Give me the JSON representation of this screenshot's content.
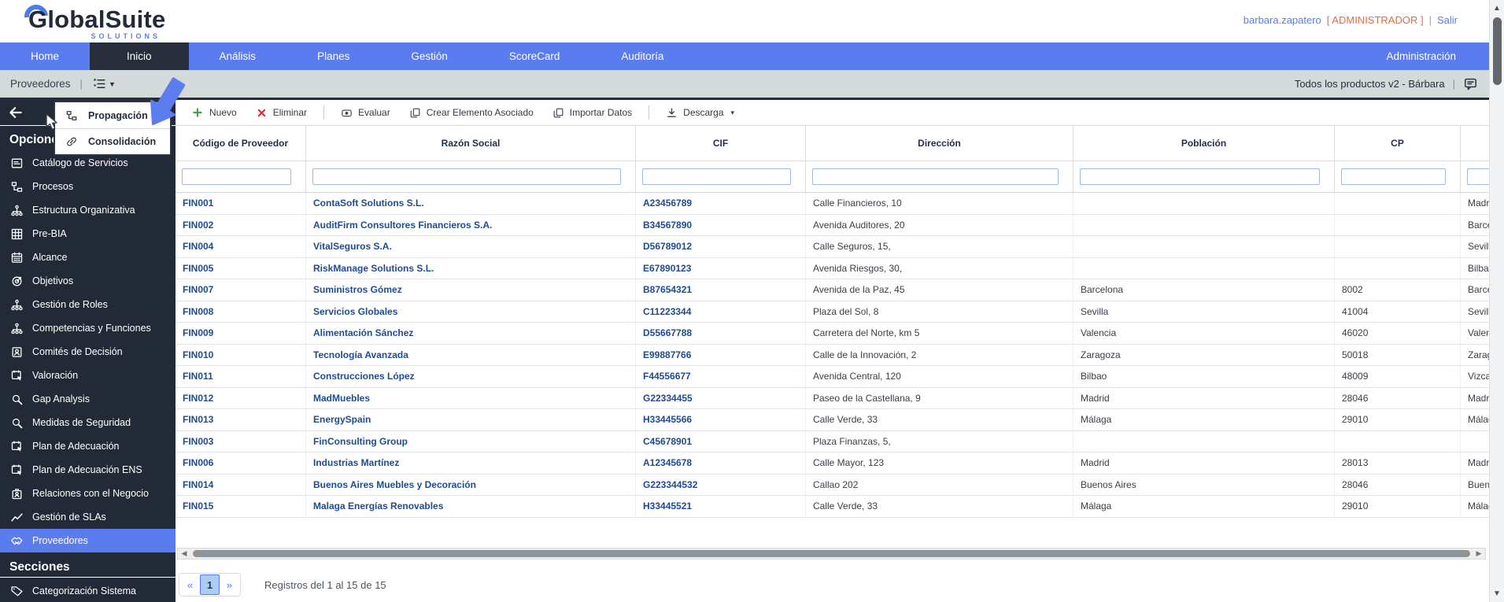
{
  "header": {
    "logo_text": "GlobalSuite",
    "logo_sub": "SOLUTIONS",
    "user": "barbara.zapatero",
    "role": "[ ADMINISTRADOR ]",
    "divider": "|",
    "logout": "Salir"
  },
  "nav": {
    "items": [
      "Home",
      "Inicio",
      "Análisis",
      "Planes",
      "Gestión",
      "ScoreCard",
      "Auditoría"
    ],
    "active": "Inicio",
    "right_item": "Administración"
  },
  "breadcrumb": {
    "title": "Proveedores",
    "sep": "|",
    "context": "Todos los productos v2 - Bárbara"
  },
  "menu": {
    "items": [
      {
        "label": "Propagación",
        "icon": "orgchart"
      },
      {
        "label": "Consolidación",
        "icon": "link"
      }
    ]
  },
  "sidebar": {
    "section_options": "Opciones",
    "section_sections": "Secciones",
    "items": [
      {
        "label": "Catálogo de Servicios",
        "icon": "doc"
      },
      {
        "label": "Procesos",
        "icon": "orgchart"
      },
      {
        "label": "Estructura Organizativa",
        "icon": "tree"
      },
      {
        "label": "Pre-BIA",
        "icon": "grid"
      },
      {
        "label": "Alcance",
        "icon": "calendar"
      },
      {
        "label": "Objetivos",
        "icon": "target"
      },
      {
        "label": "Gestión de Roles",
        "icon": "tree"
      },
      {
        "label": "Competencias y Funciones",
        "icon": "tree"
      },
      {
        "label": "Comités de Decisión",
        "icon": "idcard"
      },
      {
        "label": "Valoración",
        "icon": "calcursor"
      },
      {
        "label": "Gap Analysis",
        "icon": "search"
      },
      {
        "label": "Medidas de Seguridad",
        "icon": "search"
      },
      {
        "label": "Plan de Adecuación",
        "icon": "calcursor"
      },
      {
        "label": "Plan de Adecuación ENS",
        "icon": "calcursor"
      },
      {
        "label": "Relaciones con el Negocio",
        "icon": "badge"
      },
      {
        "label": "Gestión de SLAs",
        "icon": "chart"
      },
      {
        "label": "Proveedores",
        "icon": "handshake",
        "active": true
      }
    ],
    "items2": [
      {
        "label": "Categorización Sistema",
        "icon": "tag"
      }
    ]
  },
  "toolbar": {
    "buttons": [
      {
        "id": "nuevo",
        "label": "Nuevo",
        "icon": "plus"
      },
      {
        "id": "eliminar",
        "label": "Eliminar",
        "icon": "x"
      },
      {
        "id": "evaluar",
        "label": "Evaluar",
        "icon": "eval",
        "sep_before": true
      },
      {
        "id": "crear-elemento-asociado",
        "label": "Crear Elemento Asociado",
        "icon": "copy"
      },
      {
        "id": "importar-datos",
        "label": "Importar Datos",
        "icon": "copy"
      },
      {
        "id": "descarga",
        "label": "Descarga",
        "icon": "download",
        "caret": true,
        "sep_before": true
      }
    ],
    "caret": "▾"
  },
  "table": {
    "columns": [
      "Código de Proveedor",
      "Razón Social",
      "CIF",
      "Dirección",
      "Población",
      "CP",
      ""
    ],
    "rows": [
      [
        "FIN001",
        "ContaSoft Solutions S.L.",
        "A23456789",
        "Calle Financieros, 10",
        "",
        "",
        "Madrid"
      ],
      [
        "FIN002",
        "AuditFirm Consultores Financieros S.A.",
        "B34567890",
        "Avenida Auditores, 20",
        "",
        "",
        "Barcelona"
      ],
      [
        "FIN004",
        "VitalSeguros S.A.",
        "D56789012",
        "Calle Seguros, 15,",
        "",
        "",
        "Sevilla"
      ],
      [
        "FIN005",
        "RiskManage Solutions S.L.",
        "E67890123",
        "Avenida Riesgos, 30,",
        "",
        "",
        "Bilbao"
      ],
      [
        "FIN007",
        "Suministros Gómez",
        "B87654321",
        "Avenida de la Paz, 45",
        "Barcelona",
        "8002",
        "Barcelona"
      ],
      [
        "FIN008",
        "Servicios Globales",
        "C11223344",
        "Plaza del Sol, 8",
        "Sevilla",
        "41004",
        "Sevilla"
      ],
      [
        "FIN009",
        "Alimentación Sánchez",
        "D55667788",
        "Carretera del Norte, km 5",
        "Valencia",
        "46020",
        "Valencia"
      ],
      [
        "FIN010",
        "Tecnología Avanzada",
        "E99887766",
        "Calle de la Innovación, 2",
        "Zaragoza",
        "50018",
        "Zaragoza"
      ],
      [
        "FIN011",
        "Construcciones López",
        "F44556677",
        "Avenida Central, 120",
        "Bilbao",
        "48009",
        "Vizcaya"
      ],
      [
        "FIN012",
        "MadMuebles",
        "G22334455",
        "Paseo de la Castellana, 9",
        "Madrid",
        "28046",
        "Madrid"
      ],
      [
        "FIN013",
        "EnergySpain",
        "H33445566",
        "Calle Verde, 33",
        "Málaga",
        "29010",
        "Málaga"
      ],
      [
        "FIN003",
        "FinConsulting Group",
        "C45678901",
        "Plaza Finanzas, 5,",
        "",
        "",
        ""
      ],
      [
        "FIN006",
        "Industrias Martínez",
        "A12345678",
        "Calle Mayor, 123",
        "Madrid",
        "28013",
        "Madrid"
      ],
      [
        "FIN014",
        "Buenos Aires Muebles y Decoración",
        "G223344532",
        "Callao 202",
        "Buenos Aires",
        "28046",
        "Buenos Aires"
      ],
      [
        "FIN015",
        "Malaga Energías Renovables",
        "H33445521",
        "Calle Verde, 33",
        "Málaga",
        "29010",
        "Málaga"
      ]
    ]
  },
  "pagination": {
    "prev": "«",
    "page": "1",
    "next": "»",
    "summary": "Registros del 1 al 15 de 15"
  },
  "colors": {
    "accent_blue": "#5A7CEF",
    "nav_active_dark": "#272D3A",
    "sidebar_bg": "#222A38",
    "role_orange": "#E96A45",
    "cell_link_blue": "#1E4B94",
    "new_green": "#3EA43E",
    "delete_red": "#D42B2B"
  }
}
